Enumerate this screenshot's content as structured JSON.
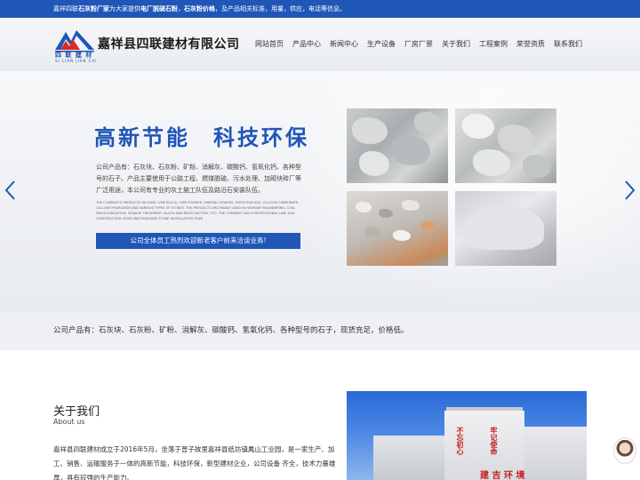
{
  "topbar": {
    "text_1": "嘉祥四联",
    "bold_1": "石灰粉厂家",
    "text_2": "为大家提供",
    "bold_2": "电厂脱硫石粉",
    "text_3": "，",
    "bold_3": "石灰粉价格",
    "text_4": "，及产品相关标准，用量，供应，电话等信息。"
  },
  "header": {
    "logo_cn": "四 联 建 材",
    "logo_en": "SI LIAN JIAN CAI",
    "company_name": "嘉祥县四联建材有限公司",
    "nav": [
      "网站首页",
      "产品中心",
      "新闻中心",
      "生产设备",
      "厂房厂景",
      "关于我们",
      "工程案例",
      "荣誉资质",
      "联系我们"
    ]
  },
  "banner": {
    "slogan_1": "高新节能",
    "slogan_2": "科技环保",
    "description": "公司产品有：石灰块、石灰粉、矿粉、消解灰、碳酸钙、氢氧化钙、各种型号的石子。产品主要使用于公路工程、燃煤脱硫、污水处理、加砌块砖厂等广泛用途，本公司有专业的灰土施工队伍及路沿石安装队伍。",
    "description_en": "The company's products include: lime block, lime powder, mineral powder, digestion ash, calcium carbonate, calcium hydroxide and various types of stones. The products are mainly used in highway engineering, coal desulfurization, sewage treatment, block and brick factory, etc. The company has a professional lime soil construction team and roadside stone installation team",
    "button_label": "公司全体员工热烈欢迎新老客户前来洽谈业务!",
    "prev_icon": "chevron-left-icon",
    "next_icon": "chevron-right-icon"
  },
  "intro": {
    "text": "公司产品有：石灰块、石灰粉、矿粉、消解灰、碳酸钙、氢氧化钙、各种型号的石子，现货充足，价格低。"
  },
  "about": {
    "title": "关于我们",
    "subtitle": "About us",
    "text": "嘉祥县四联建材成立于2016年5月，坐落于曾子故里嘉祥县纸坊镇鳳山工业园，是一家生产、加工、销售、运输服务于一体的高新节能，科技环保，新型建材企业，公司设备 齐全，技术力量雄厚，具有较强的生产能力。"
  },
  "building_photo": {
    "red_text_1": "不忘初心",
    "red_text_2": "牢记使命",
    "sign": "建 吉 环 境"
  },
  "colors": {
    "brand_blue": "#1f56b8",
    "sign_red": "#c81e1e"
  }
}
